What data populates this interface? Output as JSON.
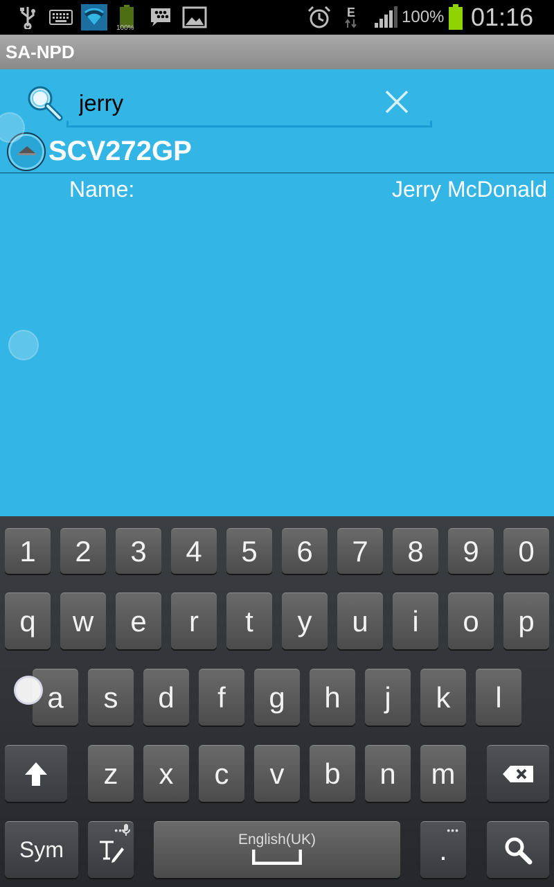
{
  "status_bar": {
    "icons": [
      "usb-icon",
      "keyboard-icon",
      "wifi-icon",
      "battery-small-icon",
      "bbm-icon",
      "gallery-icon",
      "alarm-icon",
      "edge-data-icon",
      "signal-icon",
      "battery-icon"
    ],
    "battery_small_label": "100%",
    "network_type": "E",
    "battery_percent": "100%",
    "time": "01:16"
  },
  "app": {
    "title": "SA-NPD"
  },
  "search": {
    "value": "jerry",
    "placeholder": ""
  },
  "result": {
    "group_title": "SCV272GP",
    "fields": [
      {
        "label": "Name:",
        "value": "Jerry McDonald"
      }
    ]
  },
  "keyboard": {
    "numbers": [
      "1",
      "2",
      "3",
      "4",
      "5",
      "6",
      "7",
      "8",
      "9",
      "0"
    ],
    "row1": [
      "q",
      "w",
      "e",
      "r",
      "t",
      "y",
      "u",
      "i",
      "o",
      "p"
    ],
    "row2": [
      "a",
      "s",
      "d",
      "f",
      "g",
      "h",
      "j",
      "k",
      "l"
    ],
    "row3": [
      "z",
      "x",
      "c",
      "v",
      "b",
      "n",
      "m"
    ],
    "sym_label": "Sym",
    "space_language": "English(UK)",
    "period_label": "."
  },
  "colors": {
    "accent": "#33b5e5",
    "titlebar": "#9a9a9a",
    "keyboard_bg": "#2f3134"
  }
}
